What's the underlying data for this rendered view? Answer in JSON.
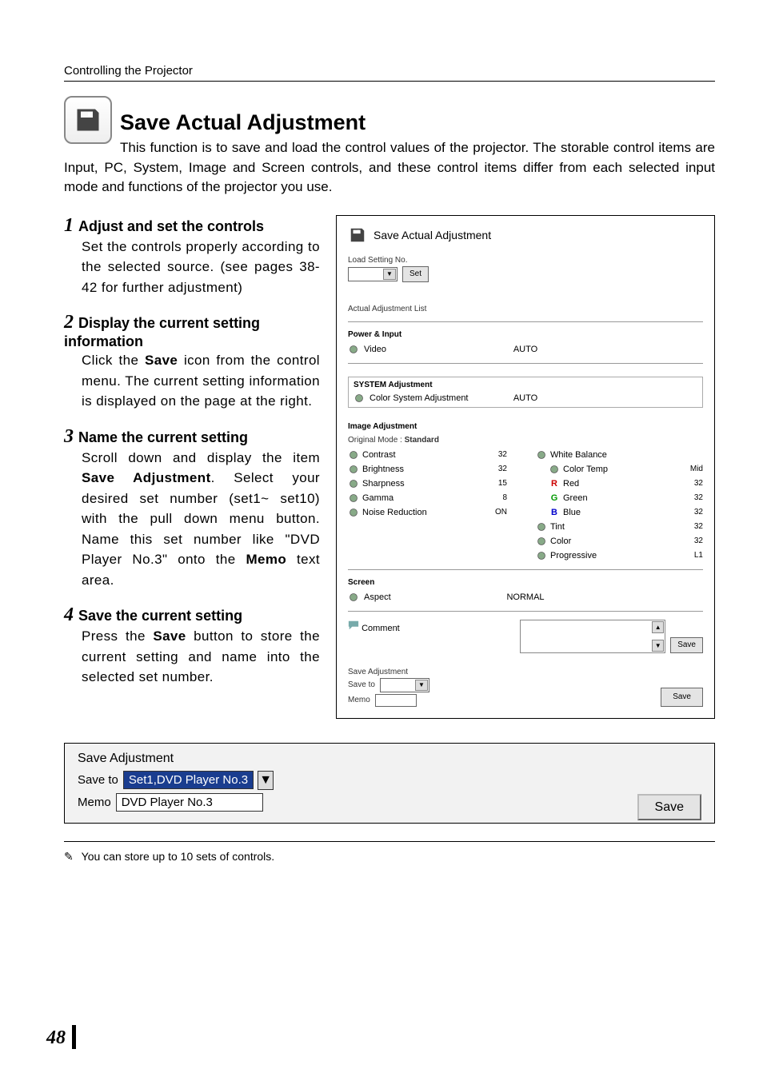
{
  "running_head": "Controlling the Projector",
  "title": "Save Actual Adjustment",
  "lead": "This function is to save and load the control values of the projector. The storable control items are Input, PC, System, Image and Screen controls, and these control items differ from each selected input mode and functions of the projector you use.",
  "steps": [
    {
      "num": "1",
      "head": "Adjust and set the controls",
      "body_html": "Set the controls properly according to the selected source. (see pages 38-42 for further adjustment)"
    },
    {
      "num": "2",
      "head": "Display the current setting information",
      "body_html": "Click the <b>Save</b> icon from the control menu. The current setting information is displayed on the page at the right."
    },
    {
      "num": "3",
      "head": "Name the current setting",
      "body_html": "Scroll down and display the item <b>Save Adjustment</b>. Select your desired set number (set1~ set10) with the pull down menu button. Name this set number like \"DVD Player No.3\" onto the <b>Memo</b> text area."
    },
    {
      "num": "4",
      "head": "Save the current setting",
      "body_html": "Press the <b>Save</b> button to store the current setting and name into the selected set number."
    }
  ],
  "screenshot": {
    "title": "Save Actual Adjustment",
    "load_label": "Load Setting No.",
    "set_btn": "Set",
    "list_label": "Actual Adjustment List",
    "power_input": {
      "heading": "Power & Input",
      "rows": [
        {
          "icon": "video-icon",
          "label": "Video",
          "value": "AUTO"
        }
      ]
    },
    "system_adj": {
      "heading": "SYSTEM Adjustment",
      "rows": [
        {
          "icon": "color-system-icon",
          "label": "Color System Adjustment",
          "value": "AUTO"
        }
      ]
    },
    "image_adj": {
      "heading": "Image Adjustment",
      "original_mode_label": "Original Mode :",
      "original_mode_value": "Standard",
      "left": [
        {
          "icon": "contrast-icon",
          "label": "Contrast",
          "value": "32"
        },
        {
          "icon": "brightness-icon",
          "label": "Brightness",
          "value": "32"
        },
        {
          "icon": "sharpness-icon",
          "label": "Sharpness",
          "value": "15"
        },
        {
          "icon": "gamma-icon",
          "label": "Gamma",
          "value": "8"
        },
        {
          "icon": "noise-icon",
          "label": "Noise Reduction",
          "value": "ON"
        }
      ],
      "right": [
        {
          "icon": "wb-icon",
          "label": "White Balance",
          "value": ""
        },
        {
          "icon": "colortemp-icon",
          "label": "Color Temp",
          "value": "Mid",
          "sub": true
        },
        {
          "icon": "r-icon",
          "label": "Red",
          "value": "32",
          "sub": true,
          "letter": "R",
          "color": "#c00"
        },
        {
          "icon": "g-icon",
          "label": "Green",
          "value": "32",
          "sub": true,
          "letter": "G",
          "color": "#090"
        },
        {
          "icon": "b-icon",
          "label": "Blue",
          "value": "32",
          "sub": true,
          "letter": "B",
          "color": "#00c"
        },
        {
          "icon": "tint-icon",
          "label": "Tint",
          "value": "32"
        },
        {
          "icon": "color-icon",
          "label": "Color",
          "value": "32"
        },
        {
          "icon": "progressive-icon",
          "label": "Progressive",
          "value": "L1"
        }
      ]
    },
    "screen": {
      "heading": "Screen",
      "rows": [
        {
          "icon": "aspect-icon",
          "label": "Aspect",
          "value": "NORMAL"
        }
      ]
    },
    "comment_label": "Comment",
    "comment_save_btn": "Save",
    "save_adj": {
      "heading": "Save Adjustment",
      "save_to_label": "Save to",
      "memo_label": "Memo",
      "save_btn": "Save"
    }
  },
  "zoom": {
    "heading": "Save Adjustment",
    "save_to_label": "Save to",
    "save_to_value": "Set1,DVD Player No.3",
    "memo_label": "Memo",
    "memo_value": "DVD Player No.3",
    "save_btn": "Save"
  },
  "footnote": "You can store up to 10 sets of controls.",
  "page_number": "48"
}
